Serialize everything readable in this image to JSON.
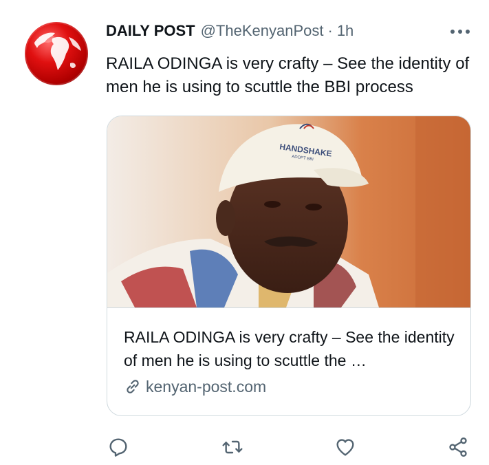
{
  "tweet": {
    "author_name": "DAILY POST",
    "handle": "@TheKenyanPost",
    "separator": "·",
    "time": "1h",
    "text": "RAILA ODINGA is very crafty – See the identity of men he is using to scuttle the BBI process"
  },
  "card": {
    "title": "RAILA ODINGA is very crafty – See the identity of men he is using to scuttle the …",
    "domain": "kenyan-post.com",
    "image_cap_text": "HANDSHAKE",
    "image_cap_subtext": "ADOPT BBI"
  },
  "icons": {
    "more": "more-horizontal-icon",
    "reply": "reply-icon",
    "retweet": "retweet-icon",
    "like": "heart-icon",
    "share": "share-icon",
    "link": "link-icon"
  },
  "colors": {
    "text_primary": "#0f1419",
    "text_secondary": "#536471",
    "border": "#cfd9de",
    "avatar_red": "#d40000"
  }
}
